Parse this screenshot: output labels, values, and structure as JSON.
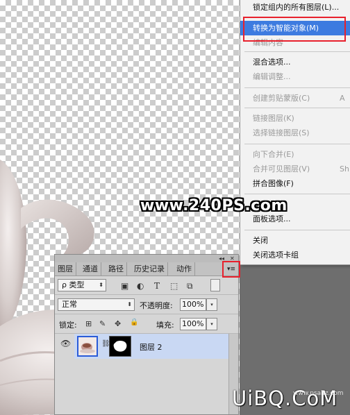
{
  "menu": {
    "items": [
      {
        "label": "锁定组内的所有图层(L)...",
        "enabled": true,
        "highlighted": false
      },
      {
        "label": "转换为智能对象(M)",
        "enabled": true,
        "highlighted": true
      },
      {
        "label": "编辑内容",
        "enabled": false,
        "highlighted": false
      },
      {
        "label": "混合选项...",
        "enabled": true,
        "highlighted": false
      },
      {
        "label": "编辑调整...",
        "enabled": false,
        "highlighted": false
      },
      {
        "label": "创建剪贴蒙版(C)",
        "enabled": false,
        "highlighted": false,
        "shortcut": "A"
      },
      {
        "label": "链接图层(K)",
        "enabled": false,
        "highlighted": false
      },
      {
        "label": "选择链接图层(S)",
        "enabled": false,
        "highlighted": false
      },
      {
        "label": "向下合并(E)",
        "enabled": false,
        "highlighted": false
      },
      {
        "label": "合并可见图层(V)",
        "enabled": false,
        "highlighted": false,
        "shortcut": "Sh"
      },
      {
        "label": "拼合图像(F)",
        "enabled": true,
        "highlighted": false
      },
      {
        "label": "动画选项",
        "enabled": true,
        "highlighted": false
      },
      {
        "label": "面板选项...",
        "enabled": true,
        "highlighted": false
      },
      {
        "label": "关闭",
        "enabled": true,
        "highlighted": false
      },
      {
        "label": "关闭选项卡组",
        "enabled": true,
        "highlighted": false
      }
    ]
  },
  "watermark": {
    "text": "www.240PS.com"
  },
  "brand": {
    "logo_text": "UiBQ.CoM",
    "sub_text": "www.psahz.com"
  },
  "layers_panel": {
    "collapse_glyph": "◂◂",
    "close_glyph": "✕",
    "tabs": [
      {
        "label": "图层",
        "active": true
      },
      {
        "label": "通道",
        "active": false
      },
      {
        "label": "路径",
        "active": false
      },
      {
        "label": "历史记录",
        "active": false
      },
      {
        "label": "动作",
        "active": false
      }
    ],
    "menu_glyph": "▾≡",
    "filter": {
      "kind_label": "ρ 类型",
      "caret": "⬍",
      "icons": [
        "image-filter-icon",
        "adjustment-filter-icon",
        "type-filter-icon",
        "shape-filter-icon",
        "smart-object-filter-icon"
      ],
      "icon_glyphs": [
        "▣",
        "◐",
        "T",
        "⬚",
        "⧉"
      ]
    },
    "blend_mode": "正常",
    "opacity_label": "不透明度:",
    "opacity_value": "100%",
    "lock_label": "锁定:",
    "lock_glyphs": [
      "⊞",
      "✎",
      "✥",
      "🔒"
    ],
    "fill_label": "填充:",
    "fill_value": "100%",
    "dropdown_caret": "▾",
    "layer": {
      "visible_glyph": "👁",
      "chain_glyph": "⛓",
      "name": "图层 2",
      "selected": true
    }
  },
  "colors": {
    "highlight": "#3d7be0",
    "annotation_red": "#e8202c",
    "selected_layer": "#c9d8f3"
  }
}
